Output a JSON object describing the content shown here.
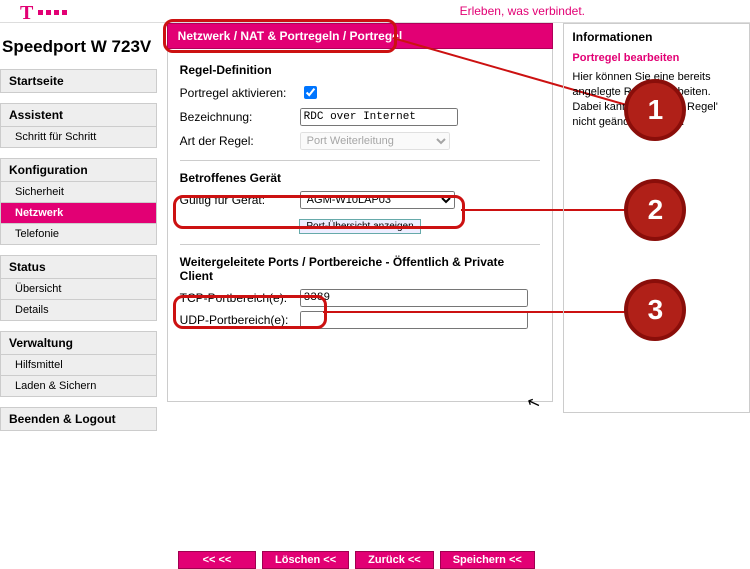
{
  "tagline": "Erleben, was verbindet.",
  "device_title": "Speedport W 723V",
  "nav": {
    "start": "Startseite",
    "assist": "Assistent",
    "assist_1": "Schritt für Schritt",
    "konfig": "Konfiguration",
    "konfig_1": "Sicherheit",
    "konfig_2": "Netzwerk",
    "konfig_3": "Telefonie",
    "status": "Status",
    "status_1": "Übersicht",
    "status_2": "Details",
    "verw": "Verwaltung",
    "verw_1": "Hilfsmittel",
    "verw_2": "Laden & Sichern",
    "logout": "Beenden & Logout"
  },
  "crumb": "Netzwerk / NAT & Portregeln / Portregel",
  "section_rule": "Regel-Definition",
  "activate_lbl": "Portregel aktivieren:",
  "activate_checked": true,
  "desc_lbl": "Bezeichnung:",
  "desc_val": "RDC over Internet",
  "type_lbl": "Art der Regel:",
  "type_val": "Port Weiterleitung",
  "section_dev": "Betroffenes Gerät",
  "dev_lbl": "Gültig für Gerät:",
  "dev_val": "AGM-W10LAP03",
  "btn_overview": "Port-Übersicht anzeigen",
  "section_ports": "Weitergeleitete Ports / Portbereiche - Öffentlich & Private Client",
  "tcp_lbl": "TCP-Portbereich(e):",
  "tcp_val": "3389",
  "udp_lbl": "UDP-Portbereich(e):",
  "udp_val": "",
  "btn_first": "<< <<",
  "btn_del": "Löschen <<",
  "btn_back": "Zurück <<",
  "btn_save": "Speichern <<",
  "info_head": "Informationen",
  "info_sub": "Portregel bearbeiten",
  "info_txt": "Hier können Sie eine bereits angelegte Regel bearbeiten. Dabei kann die 'Art der Regel' nicht geändert werden.",
  "anno": {
    "1": "1",
    "2": "2",
    "3": "3"
  }
}
